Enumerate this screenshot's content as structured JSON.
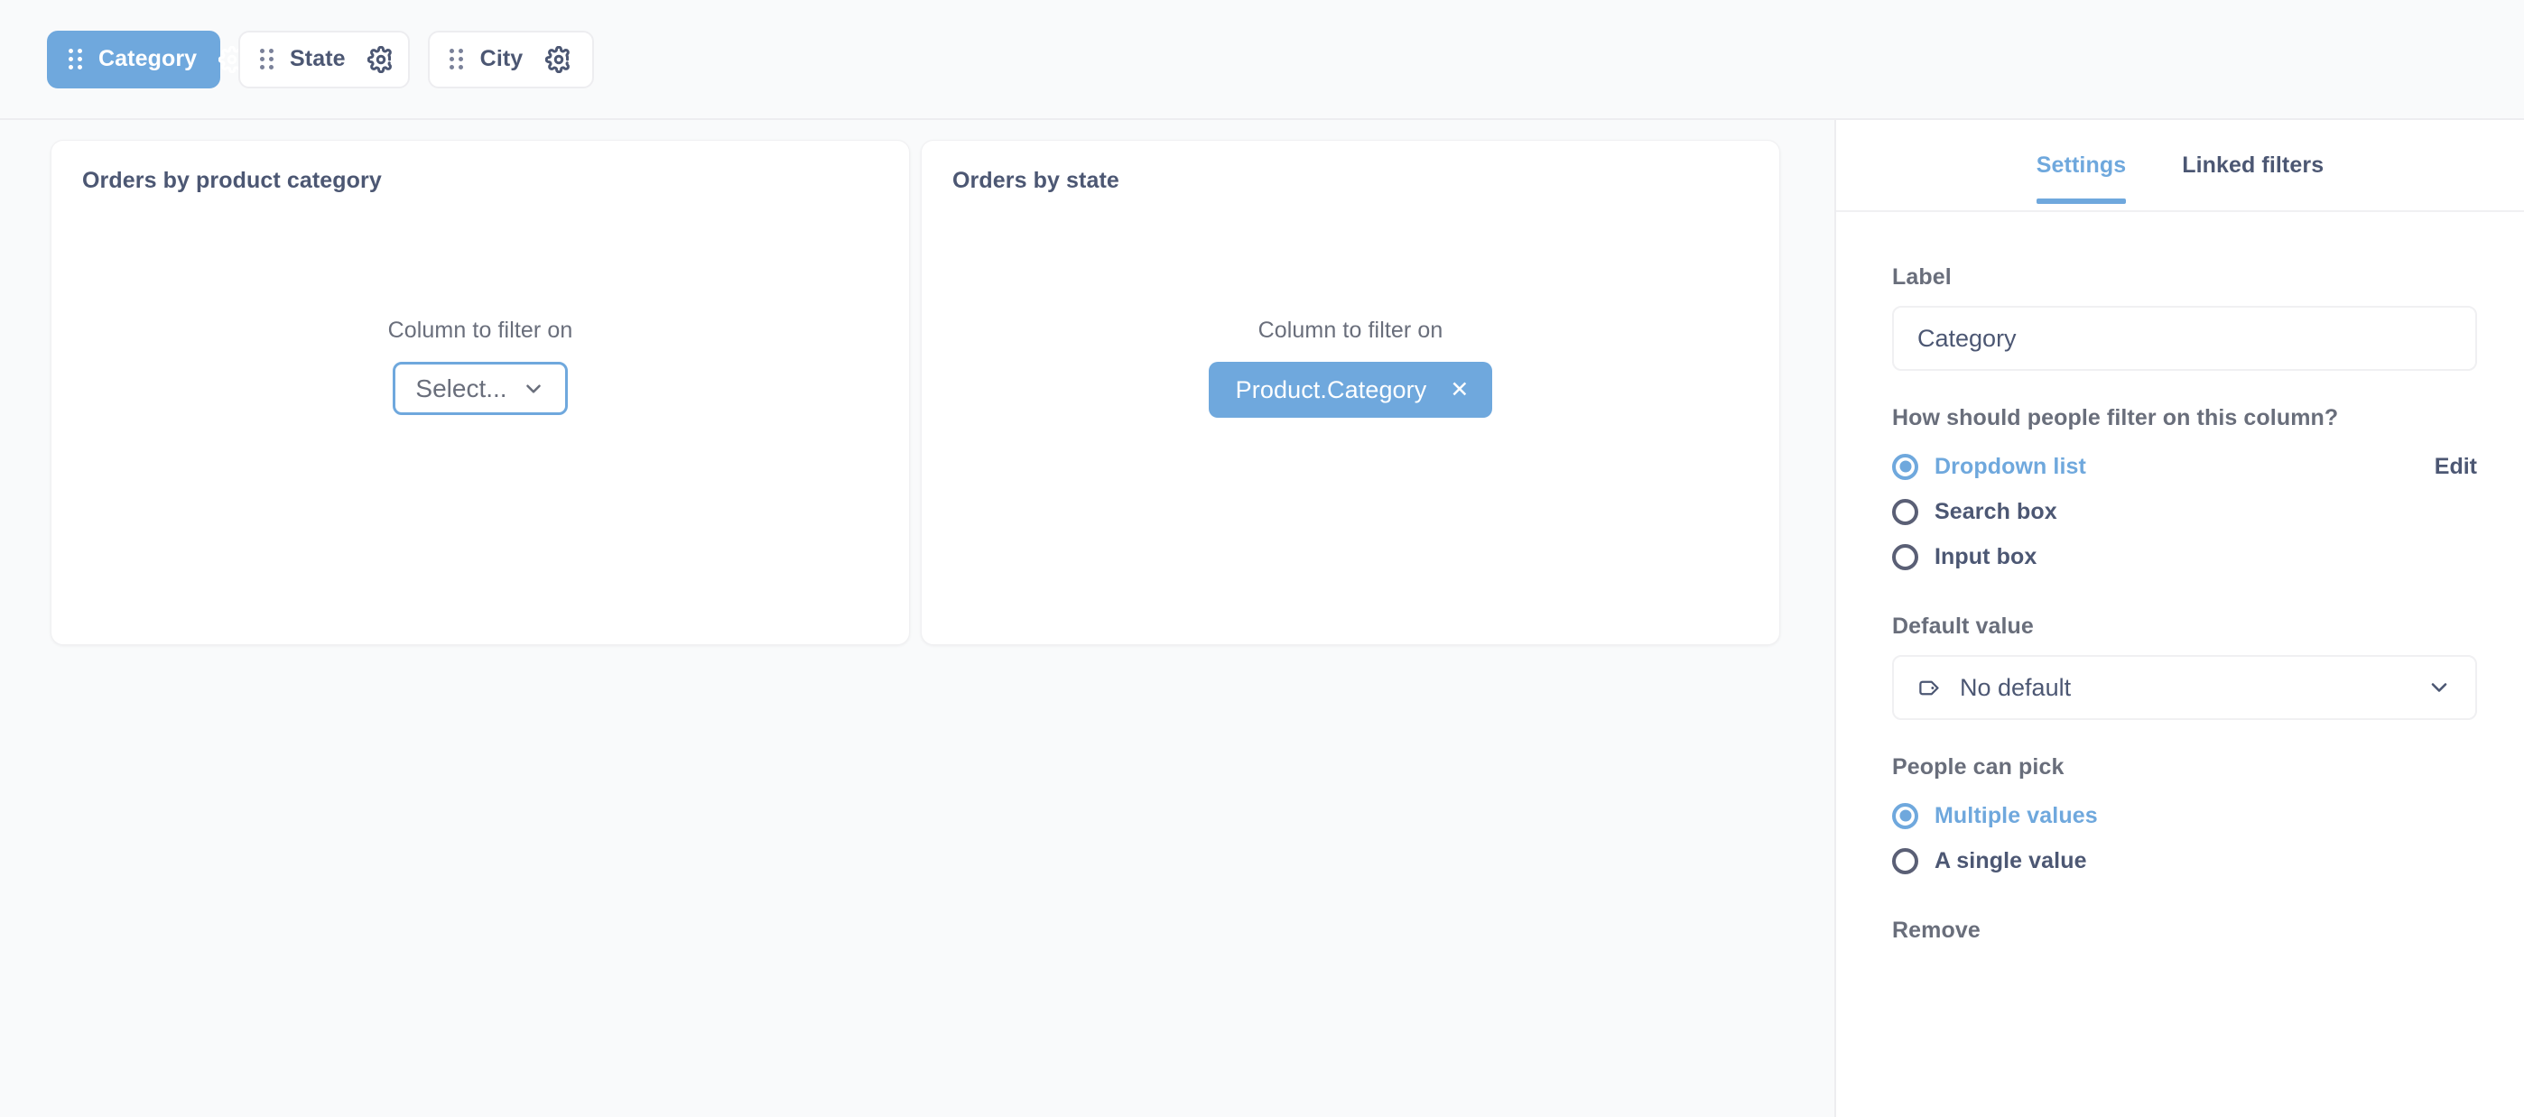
{
  "topbar": {
    "filters": [
      {
        "label": "Category",
        "active": true,
        "grip_icon": "drag-handle-icon",
        "gear_icon": "gear-icon"
      },
      {
        "label": "State",
        "active": false,
        "grip_icon": "drag-handle-icon",
        "gear_icon": "gear-icon"
      },
      {
        "label": "City",
        "active": false,
        "grip_icon": "drag-handle-icon",
        "gear_icon": "gear-icon"
      }
    ]
  },
  "canvas": {
    "cards": [
      {
        "title": "Orders by product category",
        "center_label": "Column to filter on",
        "control_type": "select",
        "select_value": "Select...",
        "chevron_icon": "chevron-down-icon"
      },
      {
        "title": "Orders by state",
        "center_label": "Column to filter on",
        "control_type": "chip",
        "chip_value": "Product.Category",
        "chip_remove_icon": "close-icon",
        "chip_remove_glyph": "✕"
      }
    ]
  },
  "sidebar": {
    "tabs": [
      {
        "label": "Settings",
        "active": true
      },
      {
        "label": "Linked filters",
        "active": false
      }
    ],
    "label_field": {
      "label": "Label",
      "value": "Category"
    },
    "filter_type": {
      "question": "How should people filter on this column?",
      "edit_link": "Edit",
      "options": [
        {
          "label": "Dropdown list",
          "selected": true
        },
        {
          "label": "Search box",
          "selected": false
        },
        {
          "label": "Input box",
          "selected": false
        }
      ]
    },
    "default_value": {
      "label": "Default value",
      "value": "No default",
      "tag_icon": "tag-icon",
      "chevron_icon": "chevron-down-icon"
    },
    "people_can_pick": {
      "label": "People can pick",
      "options": [
        {
          "label": "Multiple values",
          "selected": true
        },
        {
          "label": "A single value",
          "selected": false
        }
      ]
    },
    "remove": {
      "label": "Remove"
    }
  },
  "colors": {
    "brand": "#6fa8dd",
    "text": "#4c5773",
    "muted": "#696e7b",
    "border": "#ededf0",
    "canvas_bg": "#f9fafb"
  }
}
